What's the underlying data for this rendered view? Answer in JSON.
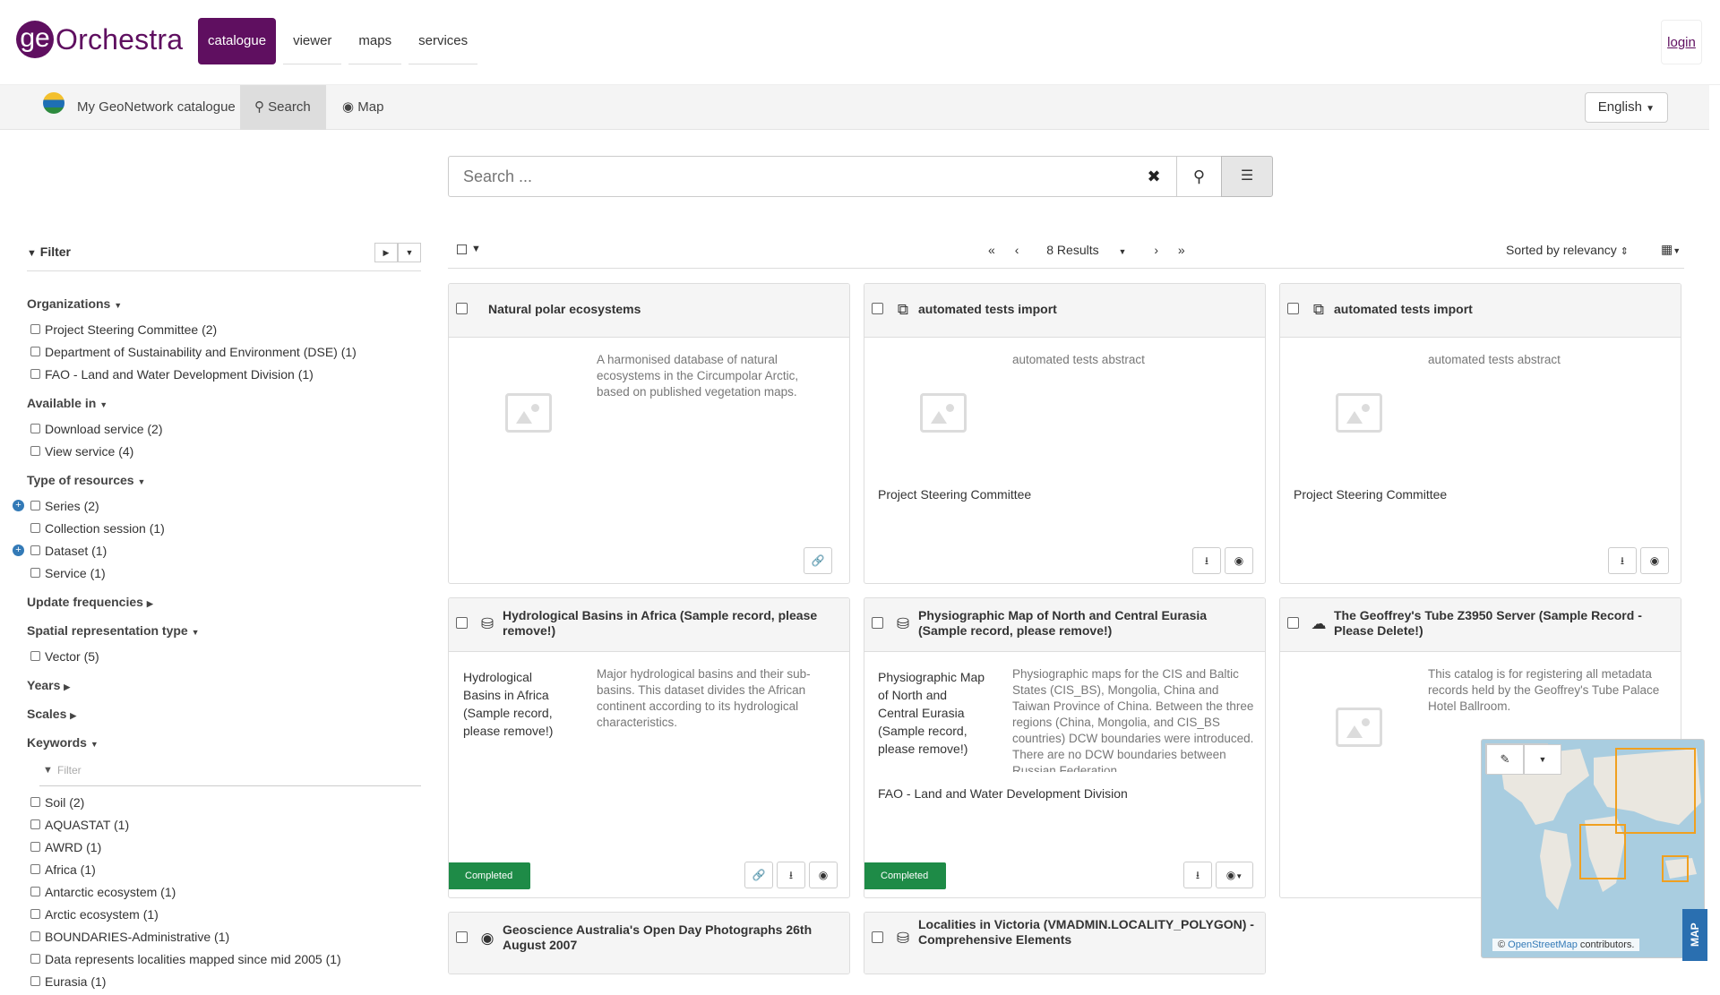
{
  "brand": {
    "prefix": "ge",
    "name": "Orchestra"
  },
  "global_nav": [
    {
      "label": "catalogue",
      "active": true
    },
    {
      "label": "viewer",
      "active": false
    },
    {
      "label": "maps",
      "active": false
    },
    {
      "label": "services",
      "active": false
    }
  ],
  "login_label": "login",
  "gn_bar": {
    "catalogue_label": "My GeoNetwork catalogue",
    "search_label": "Search",
    "map_label": "Map",
    "language": "English"
  },
  "search": {
    "placeholder": "Search ...",
    "value": ""
  },
  "toolbar": {
    "results_label": "8 Results",
    "sort_label": "Sorted by relevancy"
  },
  "filter": {
    "title": "Filter",
    "keywords_filter_placeholder": "Filter",
    "groups": [
      {
        "label": "Organizations",
        "expanded": true,
        "items": [
          "Project Steering Committee (2)",
          "Department of Sustainability and Environment (DSE) (1)",
          "FAO - Land and Water Development Division (1)"
        ]
      },
      {
        "label": "Available in",
        "expanded": true,
        "items": [
          "Download service (2)",
          "View service (4)"
        ]
      },
      {
        "label": "Type of resources",
        "expanded": true,
        "items": [
          "Series (2)",
          "Collection session (1)",
          "Dataset (1)",
          "Service (1)"
        ]
      },
      {
        "label": "Update frequencies",
        "expanded": false,
        "items": []
      },
      {
        "label": "Spatial representation type",
        "expanded": true,
        "items": [
          "Vector (5)"
        ]
      },
      {
        "label": "Years",
        "expanded": false,
        "items": []
      },
      {
        "label": "Scales",
        "expanded": false,
        "items": []
      },
      {
        "label": "Keywords",
        "expanded": true,
        "items": [
          "Soil (2)",
          "AQUASTAT (1)",
          "AWRD (1)",
          "Africa (1)",
          "Antarctic ecosystem (1)",
          "Arctic ecosystem (1)",
          "BOUNDARIES-Administrative (1)",
          "Data represents localities mapped since mid 2005 (1)",
          "Eurasia (1)"
        ]
      }
    ]
  },
  "records": [
    {
      "title": "Natural polar ecosystems",
      "abstract": "A harmonised database of natural ecosystems in the Circumpolar Arctic, based on published vegetation maps.",
      "org": ""
    },
    {
      "title": "automated tests import",
      "abstract": "automated tests abstract",
      "org": "Project Steering Committee"
    },
    {
      "title": "automated tests import",
      "abstract": "automated tests abstract",
      "org": "Project Steering Committee"
    },
    {
      "title": "Hydrological Basins in Africa (Sample record, please remove!)",
      "abstract": "Major hydrological basins and their sub-basins. This dataset divides the African continent according to its hydrological characteristics.",
      "thumb_alt": "Hydrological Basins in Africa (Sample record, please remove!)",
      "status": "Completed"
    },
    {
      "title": "Physiographic Map of North and Central Eurasia (Sample record, please remove!)",
      "abstract": "Physiographic maps for the CIS and Baltic States (CIS_BS), Mongolia, China and Taiwan Province of China. Between the three regions (China, Mongolia, and CIS_BS countries) DCW boundaries were introduced. There are no DCW boundaries between Russian Federation…",
      "thumb_alt": "Physiographic Map of North and Central Eurasia (Sample record, please remove!)",
      "org": "FAO - Land and Water Development Division",
      "status": "Completed"
    },
    {
      "title": "The Geoffrey's Tube Z3950 Server (Sample Record - Please Delete!)",
      "abstract": "This catalog is for registering all metadata records held by the Geoffrey's Tube Palace Hotel Ballroom."
    },
    {
      "title": "Geoscience Australia's Open Day Photographs 26th August 2007"
    },
    {
      "title": "Localities in Victoria (VMADMIN.LOCALITY_POLYGON) - Comprehensive Elements"
    }
  ],
  "map": {
    "attribution_prefix": "©",
    "attribution_link": "OpenStreetMap",
    "attribution_suffix": "contributors.",
    "tab_label": "MAP"
  },
  "colors": {
    "brand": "#5f0f60",
    "status_completed": "#1e8b47",
    "extent": "#f0a020"
  }
}
